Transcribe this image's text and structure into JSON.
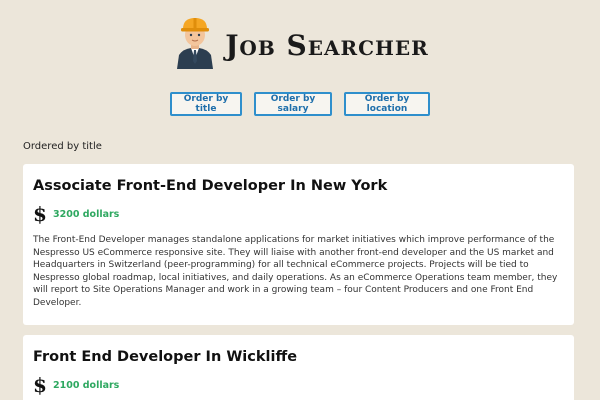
{
  "header": {
    "brand": "Job Searcher",
    "logo_icon": "worker-hardhat-icon"
  },
  "sort": {
    "by_title": "Order by title",
    "by_salary": "Order by salary",
    "by_location": "Order by location"
  },
  "status": {
    "ordered_label": "Ordered by title"
  },
  "jobs": [
    {
      "title": "Associate Front-End Developer In New York",
      "salary_icon": "dollar-sign-icon",
      "salary_symbol": "$",
      "salary": "3200 dollars",
      "description": "The Front-End Developer manages standalone applications for market initiatives which improve performance of the Nespresso US eCommerce responsive site. They will liaise with another front-end developer and the US market and Headquarters in Switzerland (peer-programming) for all technical eCommerce projects. Projects will be tied to Nespresso global roadmap, local initiatives, and daily operations. As an eCommerce Operations team member, they will report to Site Operations Manager and work in a growing team – four Content Producers and one Front End Developer."
    },
    {
      "title": "Front End Developer In Wickliffe",
      "salary_icon": "dollar-sign-icon",
      "salary_symbol": "$",
      "salary": "2100 dollars"
    }
  ],
  "colors": {
    "background": "#ece6da",
    "button_border": "#2f8fcc",
    "salary_green": "#2ea860"
  }
}
